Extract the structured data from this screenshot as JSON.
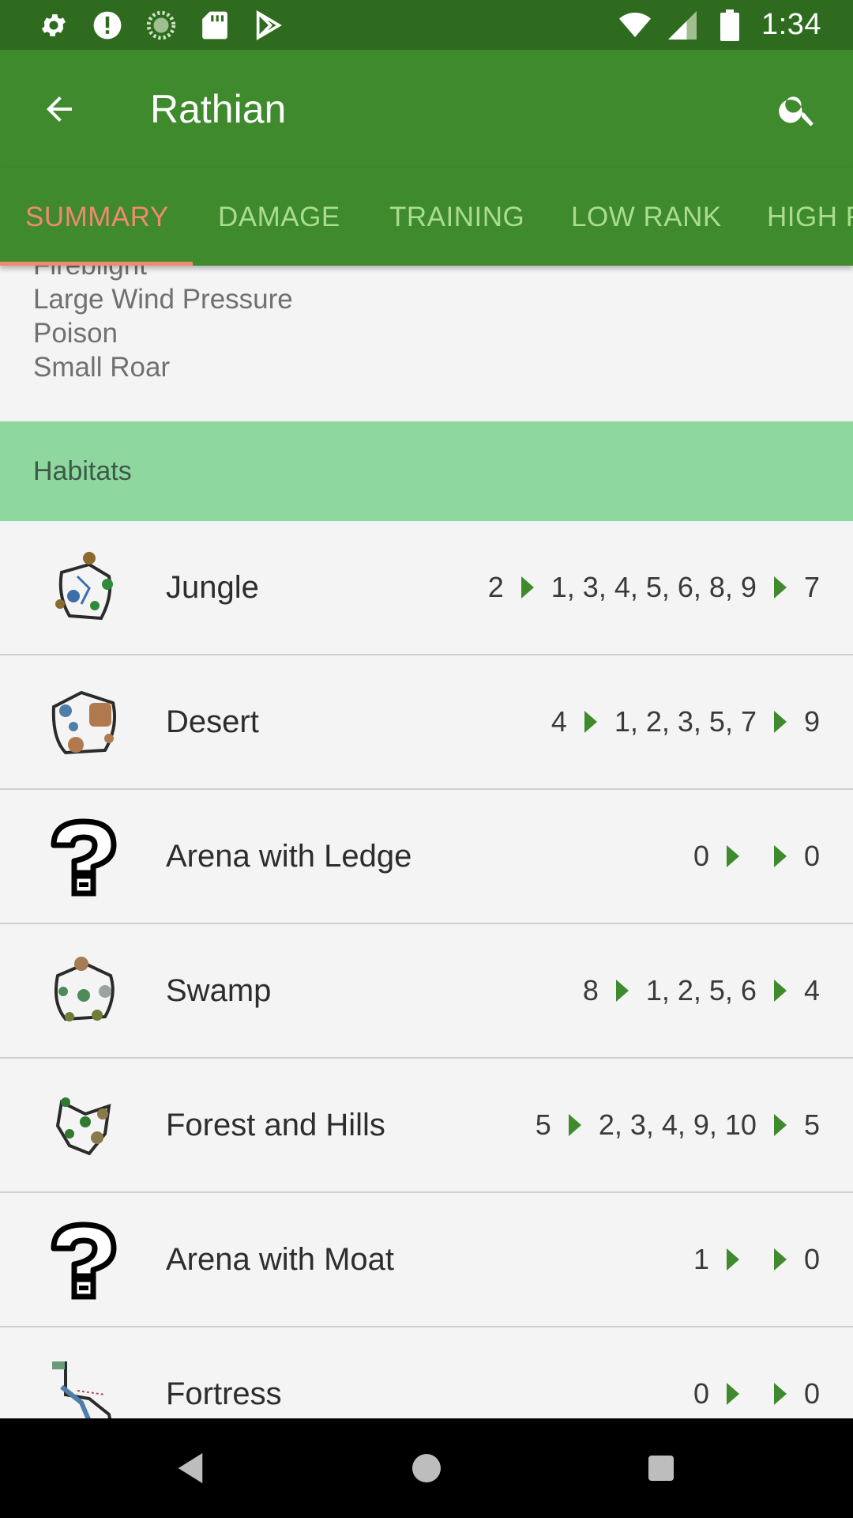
{
  "status_bar": {
    "time": "1:34",
    "left_icons": [
      "settings-icon",
      "alert-icon",
      "loading-icon",
      "sd-card-icon",
      "play-store-icon"
    ],
    "right_icons": [
      "wifi-icon",
      "signal-icon",
      "battery-icon"
    ]
  },
  "toolbar": {
    "title": "Rathian"
  },
  "tabs": [
    {
      "label": "SUMMARY",
      "active": true
    },
    {
      "label": "DAMAGE",
      "active": false
    },
    {
      "label": "TRAINING",
      "active": false
    },
    {
      "label": "LOW RANK",
      "active": false
    },
    {
      "label": "HIGH RANK",
      "active": false
    }
  ],
  "ailments": [
    "Fireblight",
    "Large Wind Pressure",
    "Poison",
    "Small Roar"
  ],
  "habitats_section": {
    "title": "Habitats"
  },
  "habitats": [
    {
      "name": "Jungle",
      "start": "2",
      "areas": "1, 3, 4, 5, 6, 8, 9",
      "rest": "7",
      "map": "jungle"
    },
    {
      "name": "Desert",
      "start": "4",
      "areas": "1, 2, 3, 5, 7",
      "rest": "9",
      "map": "desert"
    },
    {
      "name": "Arena with Ledge",
      "start": "0",
      "areas": "",
      "rest": "0",
      "map": "unknown"
    },
    {
      "name": "Swamp",
      "start": "8",
      "areas": "1, 2, 5, 6",
      "rest": "4",
      "map": "swamp"
    },
    {
      "name": "Forest and Hills",
      "start": "5",
      "areas": "2, 3, 4, 9, 10",
      "rest": "5",
      "map": "forest"
    },
    {
      "name": "Arena with Moat",
      "start": "1",
      "areas": "",
      "rest": "0",
      "map": "unknown"
    },
    {
      "name": "Fortress",
      "start": "0",
      "areas": "",
      "rest": "0",
      "map": "fortress"
    }
  ],
  "colors": {
    "status_bar": "#2f6b1f",
    "toolbar": "#3f8a2c",
    "tab_active": "#f08a6c",
    "tab_inactive": "#a9dd8d",
    "section_header": "#8ed8a0"
  }
}
